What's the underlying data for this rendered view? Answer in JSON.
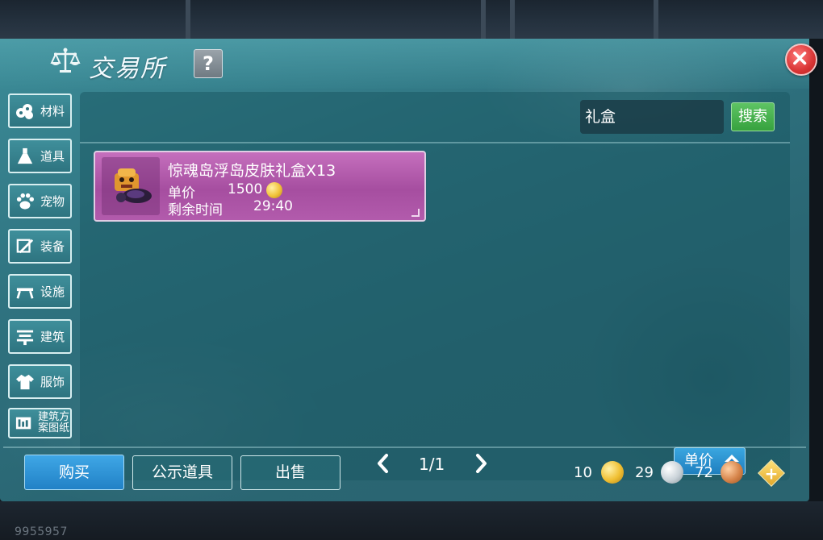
{
  "header": {
    "title": "交易所",
    "help_label": "?",
    "close_label": "✕"
  },
  "sidebar": {
    "items": [
      {
        "label": "材料",
        "icon": "cotton-icon"
      },
      {
        "label": "道具",
        "icon": "flask-icon"
      },
      {
        "label": "宠物",
        "icon": "paw-icon"
      },
      {
        "label": "装备",
        "icon": "sword-icon"
      },
      {
        "label": "设施",
        "icon": "sawhorse-icon"
      },
      {
        "label": "建筑",
        "icon": "building-icon"
      },
      {
        "label": "服饰",
        "icon": "shirt-icon"
      },
      {
        "label": "建筑方案图纸",
        "icon": "blueprint-icon"
      }
    ]
  },
  "search": {
    "value": "礼盒",
    "button_label": "搜索"
  },
  "listing": {
    "name": "惊魂岛浮岛皮肤礼盒X13",
    "price_label": "单价",
    "price": "1500",
    "time_label": "剩余时间",
    "time_remaining": "29:40"
  },
  "pager": {
    "text": "1/1"
  },
  "sort": {
    "label": "单价"
  },
  "bottom": {
    "buy_label": "购买",
    "public_label": "公示道具",
    "sell_label": "出售"
  },
  "currency": {
    "gold": "10",
    "silver": "29",
    "bronze": "72"
  },
  "player_id": "9955957",
  "colors": {
    "panel_teal": "#2f7380",
    "item_purple": "#a64ea0",
    "search_green": "#36a23e",
    "button_blue": "#2181c6",
    "close_red": "#d93535"
  }
}
